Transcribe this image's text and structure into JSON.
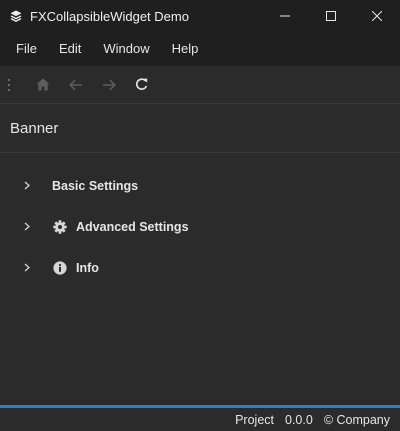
{
  "window": {
    "title": "FXCollapsibleWidget Demo",
    "icon": "stack-icon",
    "controls": [
      "minimize-icon",
      "maximize-icon",
      "close-icon"
    ]
  },
  "menu": {
    "items": [
      "File",
      "Edit",
      "Window",
      "Help"
    ]
  },
  "toolbar": {
    "buttons": [
      {
        "icon": "home-icon",
        "enabled": false
      },
      {
        "icon": "arrow-left-icon",
        "enabled": false
      },
      {
        "icon": "arrow-right-icon",
        "enabled": false
      },
      {
        "icon": "refresh-icon",
        "enabled": true
      }
    ]
  },
  "banner": {
    "text": "Banner"
  },
  "sections": [
    {
      "label": "Basic Settings",
      "icon": null,
      "expanded": false
    },
    {
      "label": "Advanced Settings",
      "icon": "gear-icon",
      "expanded": false
    },
    {
      "label": "Info",
      "icon": "info-icon",
      "expanded": false
    }
  ],
  "status": {
    "project": "Project",
    "version": "0.0.0",
    "company": "© Company"
  },
  "colors": {
    "accent": "#1e86d8",
    "background": "#2b2b2b",
    "chrome": "#1f1f1f",
    "text": "#e6e6e6"
  }
}
